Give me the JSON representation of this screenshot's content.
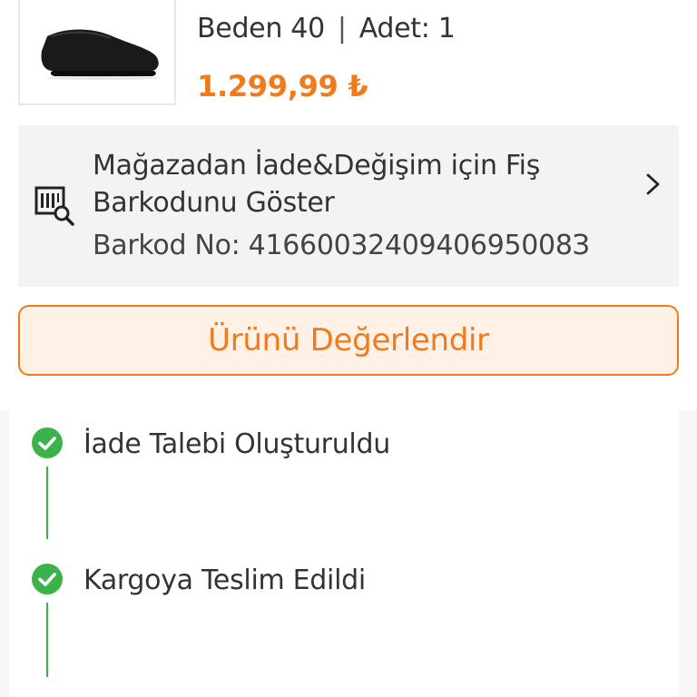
{
  "product": {
    "image_alt": "black flat shoe",
    "size": "Beden 40",
    "separator": "|",
    "quantity": "Adet: 1",
    "price": "1.299,99 ₺"
  },
  "barcode_card": {
    "title": "Mağazadan İade&Değişim için Fiş Barkodunu Göster",
    "number": "Barkod No: 4166003240940695008З",
    "icon": "barcode-search-icon",
    "chevron": "chevron-right-icon"
  },
  "rate_button": {
    "label": "Ürünü Değerlendir"
  },
  "timeline": {
    "steps": [
      {
        "label": "İade Talebi Oluşturuldu",
        "status": "done"
      },
      {
        "label": "Kargoya Teslim Edildi",
        "status": "done"
      }
    ]
  },
  "colors": {
    "accent": "#f27a1a",
    "accent_bg": "#fff1e5",
    "success": "#3cb34a",
    "card_bg": "#f3f3f3",
    "text": "#333333"
  }
}
